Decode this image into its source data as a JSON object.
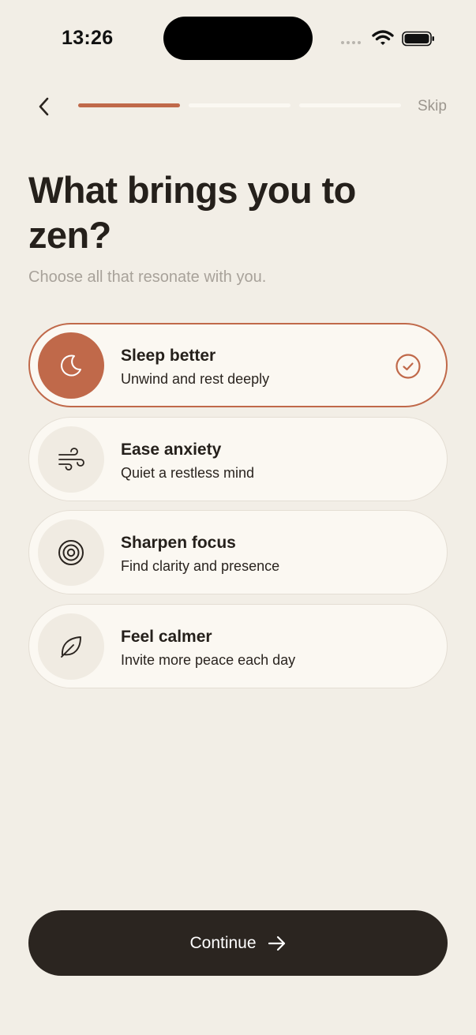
{
  "status_bar": {
    "time": "13:26"
  },
  "nav": {
    "skip_label": "Skip",
    "progress": {
      "current_step": 1,
      "total_steps": 3
    }
  },
  "header": {
    "title": "What brings you to zen?",
    "subtitle": "Choose all that resonate with you."
  },
  "options": [
    {
      "label": "Sleep better",
      "description": "Unwind and rest deeply",
      "icon": "moon-icon",
      "selected": true
    },
    {
      "label": "Ease anxiety",
      "description": "Quiet a restless mind",
      "icon": "wind-icon",
      "selected": false
    },
    {
      "label": "Sharpen focus",
      "description": "Find clarity and presence",
      "icon": "target-icon",
      "selected": false
    },
    {
      "label": "Feel calmer",
      "description": "Invite more peace each day",
      "icon": "leaf-icon",
      "selected": false
    }
  ],
  "footer": {
    "continue_label": "Continue"
  },
  "colors": {
    "background": "#F2EEE6",
    "accent": "#C0694A",
    "card": "#FBF8F2",
    "primary_button": "#2B2520",
    "muted_text": "#A8A29A"
  }
}
